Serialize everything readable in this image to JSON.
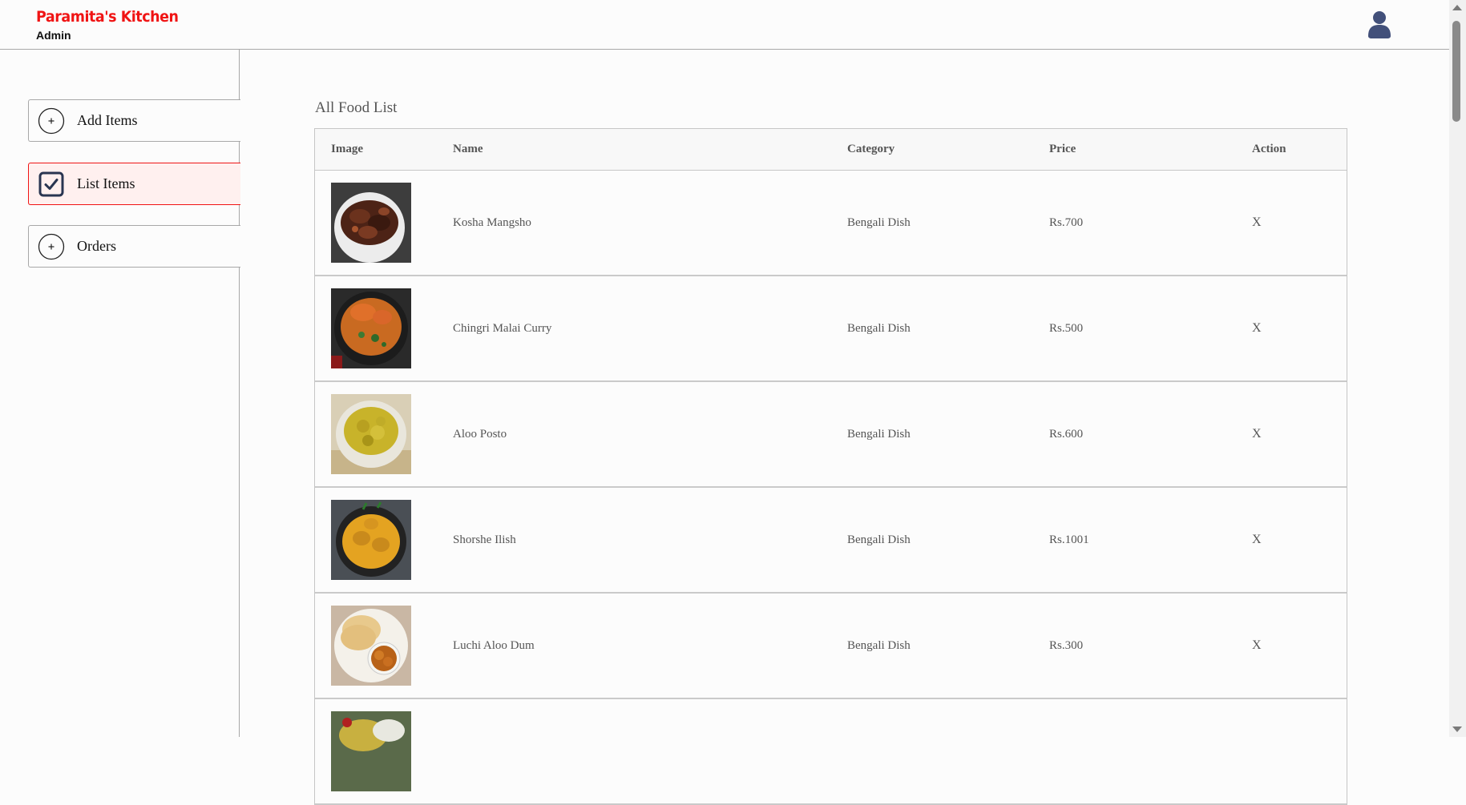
{
  "navbar": {
    "brand": "Paramita's Kitchen",
    "subtitle": "Admin",
    "profile_icon": "user-icon"
  },
  "sidebar": {
    "items": [
      {
        "label": "Add Items",
        "icon": "plus-circle-icon",
        "active": false
      },
      {
        "label": "List Items",
        "icon": "checkbox-icon",
        "active": true
      },
      {
        "label": "Orders",
        "icon": "plus-circle-icon",
        "active": false
      }
    ]
  },
  "main": {
    "title": "All Food List",
    "columns": [
      "Image",
      "Name",
      "Category",
      "Price",
      "Action"
    ],
    "rows": [
      {
        "image": "kosha-mangsho-photo",
        "name": "Kosha Mangsho",
        "category": "Bengali Dish",
        "price": "Rs.700",
        "action": "X"
      },
      {
        "image": "chingri-malai-curry-photo",
        "name": "Chingri Malai Curry",
        "category": "Bengali Dish",
        "price": "Rs.500",
        "action": "X"
      },
      {
        "image": "aloo-posto-photo",
        "name": "Aloo Posto",
        "category": "Bengali Dish",
        "price": "Rs.600",
        "action": "X"
      },
      {
        "image": "shorshe-ilish-photo",
        "name": "Shorshe Ilish",
        "category": "Bengali Dish",
        "price": "Rs.1001",
        "action": "X"
      },
      {
        "image": "luchi-aloo-dum-photo",
        "name": "Luchi Aloo Dum",
        "category": "Bengali Dish",
        "price": "Rs.300",
        "action": "X"
      },
      {
        "image": "food-photo",
        "name": "",
        "category": "",
        "price": "",
        "action": ""
      }
    ]
  },
  "colors": {
    "brand": "#f01414",
    "active_bg": "#fff0ef",
    "border": "#a8a8a8",
    "icon_dark": "#293551"
  }
}
